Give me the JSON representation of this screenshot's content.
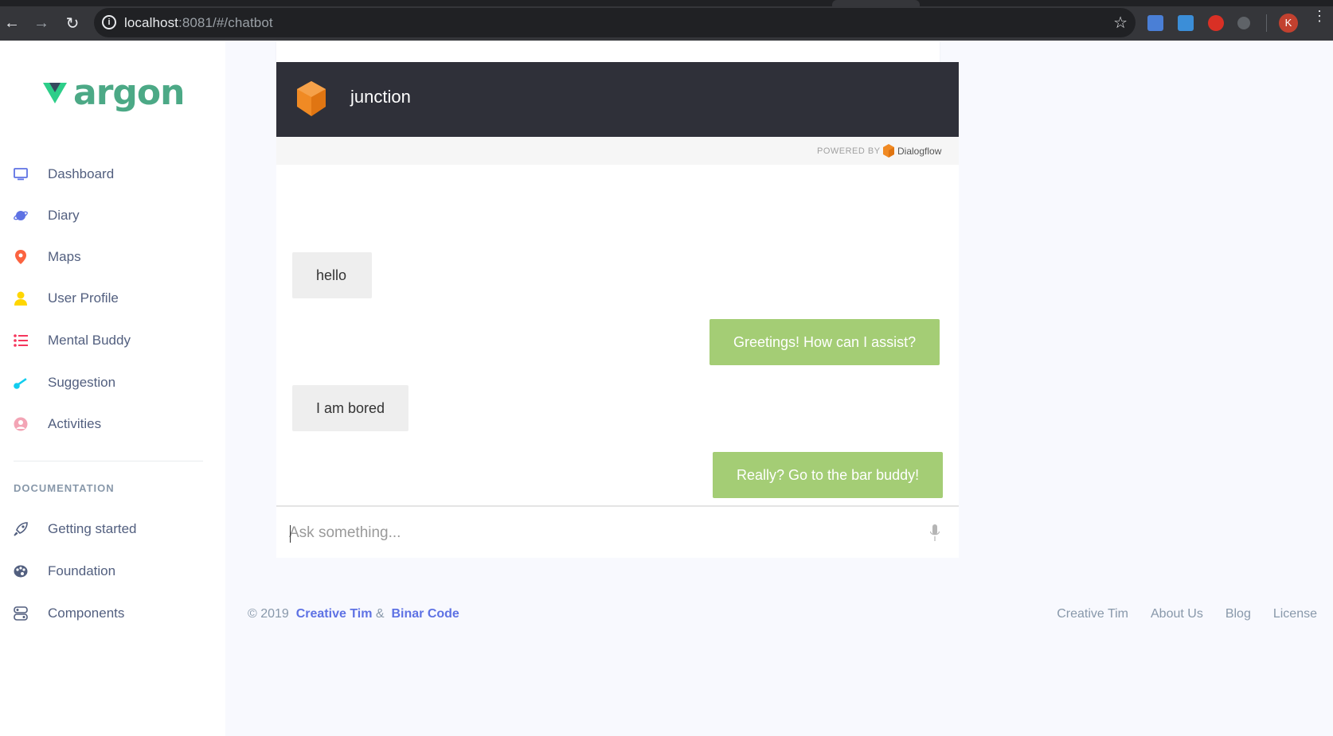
{
  "browser": {
    "url_host": "localhost",
    "url_path": ":8081/#/chatbot",
    "profile_initial": "K"
  },
  "sidebar": {
    "brand": "argon",
    "items": [
      {
        "label": "Dashboard",
        "icon": "tv-icon",
        "color": "#5e72e4"
      },
      {
        "label": "Diary",
        "icon": "planet-icon",
        "color": "#5e72e4"
      },
      {
        "label": "Maps",
        "icon": "pin-icon",
        "color": "#fb6340"
      },
      {
        "label": "User Profile",
        "icon": "user-icon",
        "color": "#ffd600"
      },
      {
        "label": "Mental Buddy",
        "icon": "list-icon",
        "color": "#f5365c"
      },
      {
        "label": "Suggestion",
        "icon": "key-icon",
        "color": "#11cdef"
      },
      {
        "label": "Activities",
        "icon": "circle-user-icon",
        "color": "#f3a4b5"
      }
    ],
    "doc_heading": "DOCUMENTATION",
    "doc_items": [
      {
        "label": "Getting started",
        "icon": "rocket-icon"
      },
      {
        "label": "Foundation",
        "icon": "palette-icon"
      },
      {
        "label": "Components",
        "icon": "ui-icon"
      }
    ]
  },
  "chat": {
    "agent_name": "junction",
    "powered_by": "POWERED BY",
    "powered_brand": "Dialogflow",
    "messages": [
      {
        "from": "user",
        "text": "hello"
      },
      {
        "from": "bot",
        "text": "Greetings! How can I assist?"
      },
      {
        "from": "user",
        "text": "I am bored"
      },
      {
        "from": "bot",
        "text": "Really? Go to the bar buddy!"
      }
    ],
    "input_placeholder": "Ask something..."
  },
  "footer": {
    "copyright": "© 2019",
    "author1": "Creative Tim",
    "amp": "&",
    "author2": "Binar Code",
    "links": [
      "Creative Tim",
      "About Us",
      "Blog",
      "License"
    ]
  },
  "colors": {
    "accent": "#5e72e4",
    "bot_bubble": "#a4cd75",
    "header_bg": "#2f3039"
  }
}
